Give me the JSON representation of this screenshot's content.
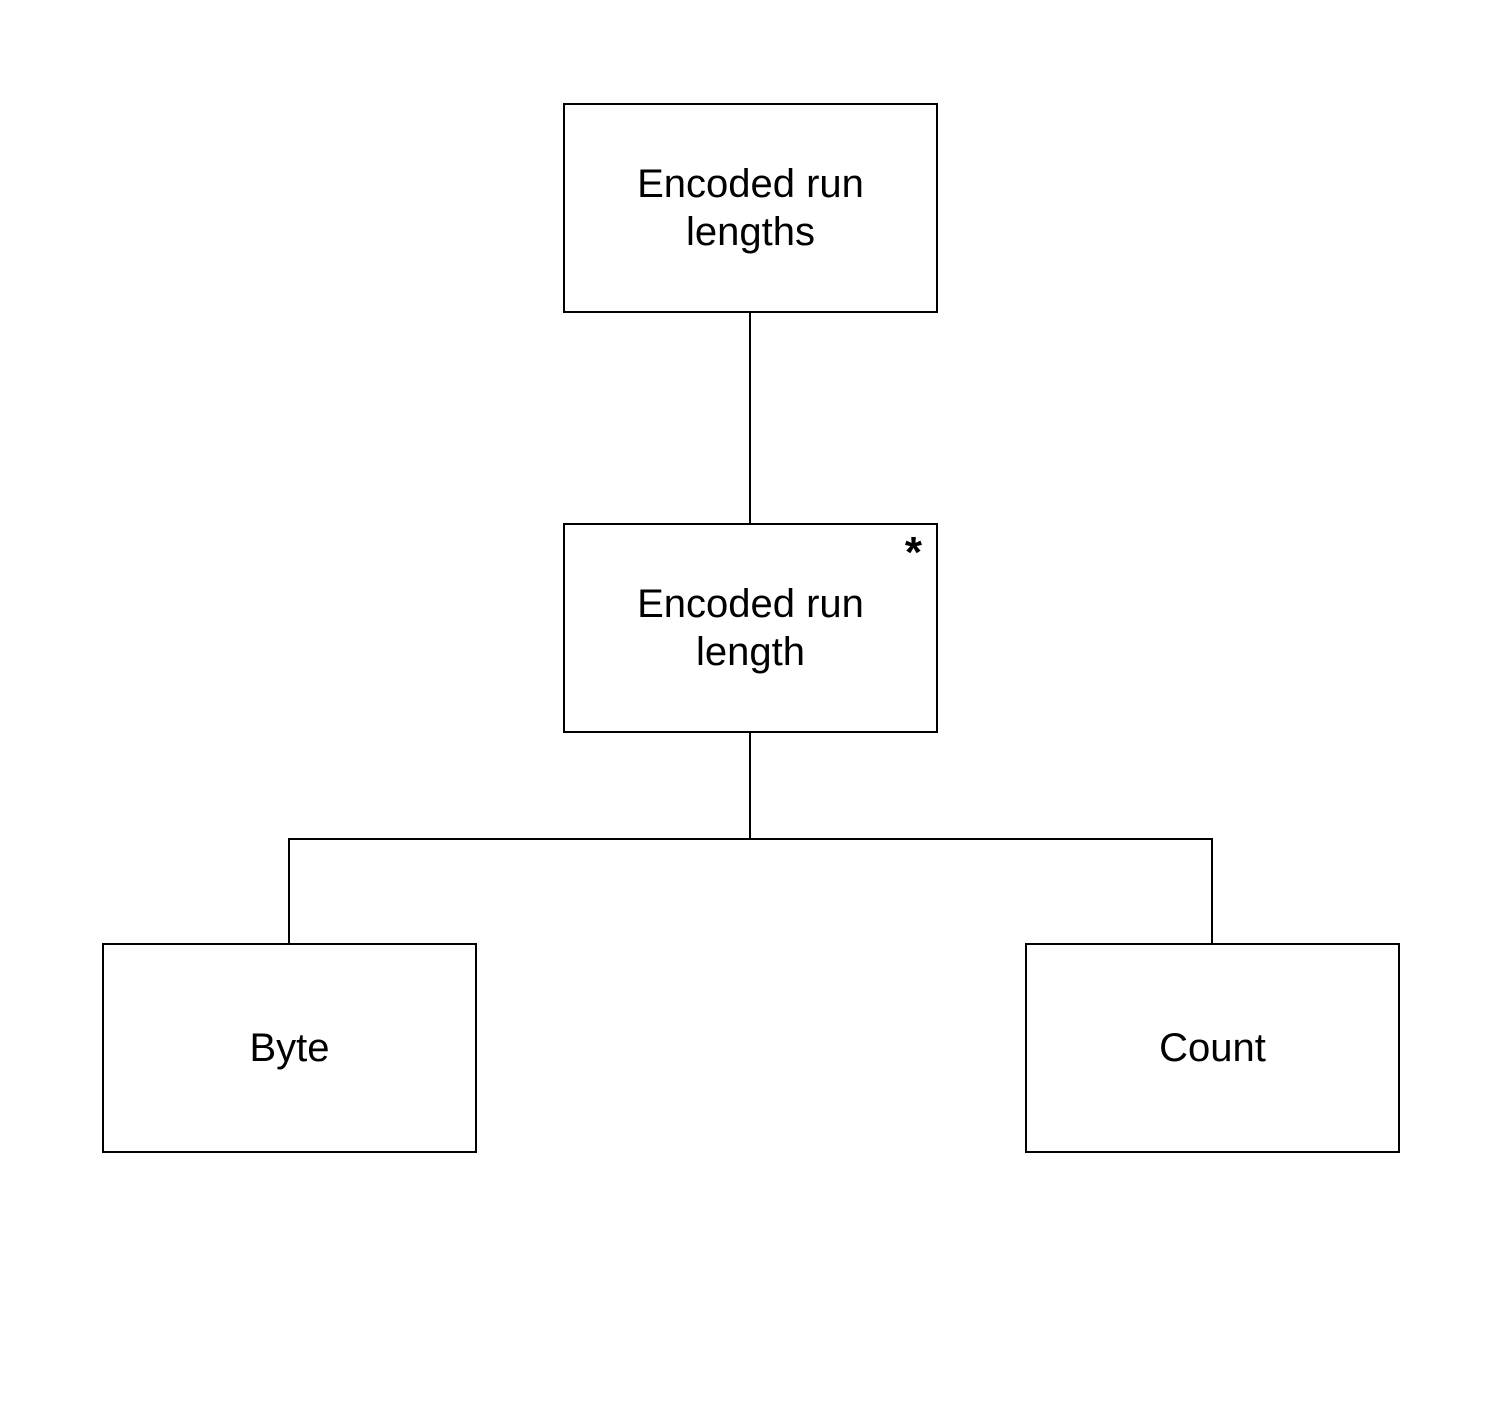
{
  "nodes": {
    "root": {
      "label": "Encoded run lengths"
    },
    "mid": {
      "label": "Encoded run length",
      "annotation": "*"
    },
    "left": {
      "label": "Byte"
    },
    "right": {
      "label": "Count"
    }
  }
}
